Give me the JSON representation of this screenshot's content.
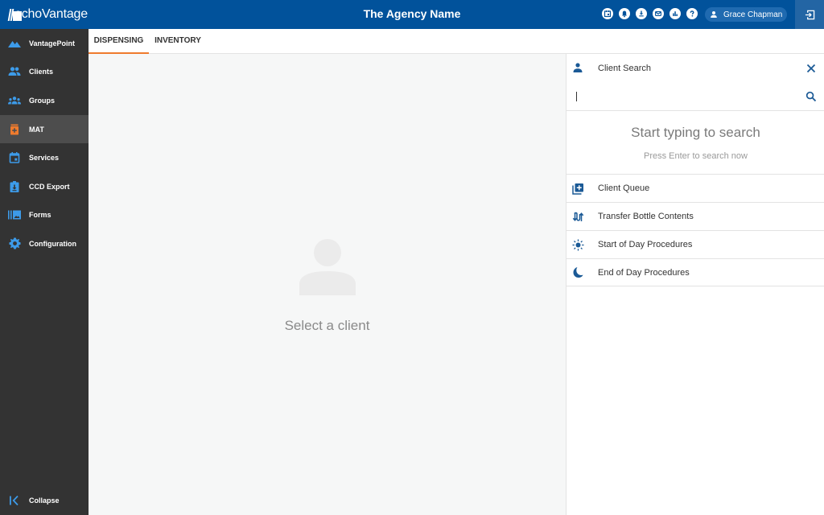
{
  "header": {
    "logo_text": "echoVantage",
    "agency_name": "The Agency Name",
    "icons": [
      "calendar-icon",
      "bell-icon",
      "download-icon",
      "mail-icon",
      "chart-icon",
      "help-icon"
    ],
    "user_name": "Grace Chapman",
    "logout_icon": "logout-icon"
  },
  "sidebar": {
    "items": [
      {
        "label": "VantagePoint",
        "icon": "mountain-icon",
        "active": false
      },
      {
        "label": "Clients",
        "icon": "people-icon",
        "active": false
      },
      {
        "label": "Groups",
        "icon": "groups-icon",
        "active": false
      },
      {
        "label": "MAT",
        "icon": "medication-bottle-icon",
        "active": true
      },
      {
        "label": "Services",
        "icon": "calendar-icon",
        "active": false
      },
      {
        "label": "CCD Export",
        "icon": "clipboard-download-icon",
        "active": false
      },
      {
        "label": "Forms",
        "icon": "forms-icon",
        "active": false
      },
      {
        "label": "Configuration",
        "icon": "gear-icon",
        "active": false
      }
    ],
    "collapse_label": "Collapse"
  },
  "tabs": [
    {
      "label": "DISPENSING",
      "active": true
    },
    {
      "label": "INVENTORY",
      "active": false
    }
  ],
  "main": {
    "empty_message": "Select a client"
  },
  "panel": {
    "title": "Client Search",
    "search_value": "",
    "empty_title": "Start typing to search",
    "empty_subtitle": "Press Enter to search now",
    "actions": [
      {
        "label": "Client Queue",
        "icon": "queue-add-icon"
      },
      {
        "label": "Transfer Bottle Contents",
        "icon": "transfer-icon"
      },
      {
        "label": "Start of Day Procedures",
        "icon": "sun-icon"
      },
      {
        "label": "End of Day Procedures",
        "icon": "moon-icon"
      }
    ]
  },
  "colors": {
    "brand_blue": "#01529b",
    "sidebar_bg": "#333333",
    "sidebar_active": "#4d4d4d",
    "icon_blue": "#3d9be9",
    "accent_orange": "#ef7b2d",
    "panel_icon_blue": "#1b5a96"
  }
}
